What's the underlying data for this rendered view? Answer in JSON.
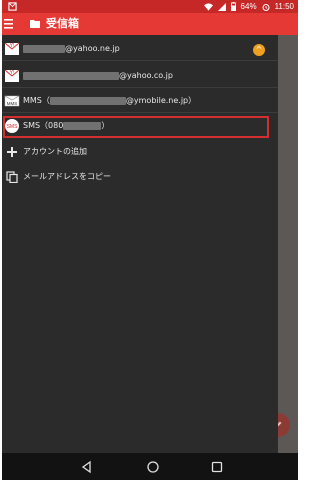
{
  "status_bar": {
    "battery": "64%",
    "time": "11:50"
  },
  "app_bar": {
    "title": "受信箱"
  },
  "accounts": [
    {
      "suffix": "@yahoo.ne.jp",
      "badge": "^"
    },
    {
      "suffix": "@yahoo.co.jp"
    },
    {
      "prefix": "MMS（",
      "suffix": "@ymobile.ne.jp）",
      "avatar_text": "MMS"
    },
    {
      "prefix": "SMS（080",
      "suffix": "）",
      "avatar_text": "SMS"
    }
  ],
  "actions": {
    "add_account": "アカウントの追加",
    "copy_address": "メールアドレスをコピー"
  },
  "colors": {
    "status_bar": "#c62828",
    "app_bar": "#e53935",
    "highlight": "#d32f2f",
    "badge": "#f0a020"
  }
}
